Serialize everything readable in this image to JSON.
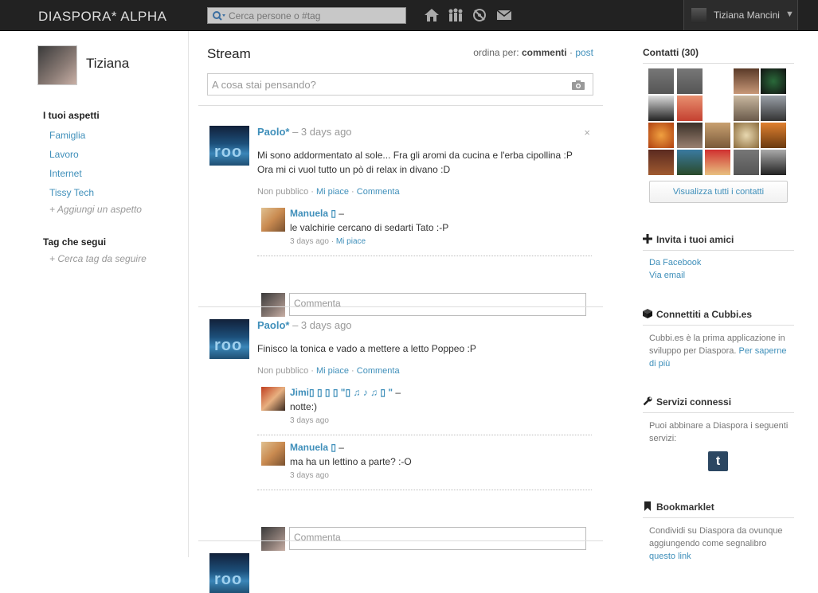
{
  "header": {
    "logo": "DIASPORA* ALPHA",
    "search_placeholder": "Cerca persone o #tag",
    "icons": [
      "home-icon",
      "contacts-icon",
      "notifications-icon",
      "messages-icon"
    ],
    "user_name": "Tiziana Mancini",
    "caret": "▼"
  },
  "left": {
    "profile_name": "Tiziana",
    "aspects_title": "I tuoi aspetti",
    "aspects": [
      "Famiglia",
      "Lavoro",
      "Internet",
      "Tissy Tech"
    ],
    "add_aspect": "+ Aggiungi un aspetto",
    "tags_title": "Tag che segui",
    "tags_search": "+ Cerca tag da seguire"
  },
  "stream": {
    "title": "Stream",
    "order_label": "ordina per:",
    "order_active": "commenti",
    "order_sep": "·",
    "order_other": "post",
    "publisher_placeholder": "A cosa stai pensando?",
    "posts": [
      {
        "author": "Paolo*",
        "time": "– 3 days ago",
        "close": "×",
        "lines": [
          "Mi sono addormentato al sole... Fra gli aromi da cucina e l'erba cipollina :P",
          "Ora mi ci vuol tutto un pò di relax in divano :D"
        ],
        "visibility": "Non pubblico ·",
        "like": "Mi piace",
        "sep": "·",
        "comment": "Commenta",
        "comments": [
          {
            "author": "Manuela ▯",
            "dash": "–",
            "text": "le valchirie cercano di sedarti Tato :-P",
            "time": "3 days ago ·",
            "like": "Mi piace"
          }
        ],
        "comment_placeholder": "Commenta"
      },
      {
        "author": "Paolo*",
        "time": "– 3 days ago",
        "lines": [
          "Finisco la tonica e vado a mettere a letto Poppeo :P"
        ],
        "visibility": "Non pubblico ·",
        "like": "Mi piace",
        "sep": "·",
        "comment": "Commenta",
        "comments": [
          {
            "author": "Jimi▯ ▯ ▯ ▯ \"▯ ♫ ♪ ♫ ▯ \"",
            "dash": "–",
            "text": "notte:)",
            "time": "3 days ago"
          },
          {
            "author": "Manuela ▯",
            "dash": "–",
            "text": "ma ha un lettino a parte? :-O",
            "time": "3 days ago"
          }
        ],
        "comment_placeholder": "Commenta"
      }
    ]
  },
  "right": {
    "contacts_title": "Contatti (30)",
    "view_all": "Visualizza tutti i contatti",
    "invite_title": "Invita i tuoi amici",
    "invite_facebook": "Da Facebook",
    "invite_email": "Via email",
    "cubbi_title": "Connettiti a Cubbi.es",
    "cubbi_text_1": "Cubbi.es è la prima applicazione in",
    "cubbi_text_2": "sviluppo per Diaspora.",
    "cubbi_link_1": "Per saperne",
    "cubbi_link_2": "di più",
    "services_title": "Servizi connessi",
    "services_text_1": "Puoi abbinare a Diaspora i seguenti",
    "services_text_2": "servizi:",
    "tumblr": "t",
    "bookmarklet_title": "Bookmarklet",
    "bookmarklet_text_1": "Condividi su Diaspora da ovunque",
    "bookmarklet_text_2": "aggiungendo come segnalibro",
    "bookmarklet_link": "questo link"
  },
  "colors": {
    "header_bg": "#222222",
    "link": "#3f8fba",
    "muted": "#999999"
  }
}
